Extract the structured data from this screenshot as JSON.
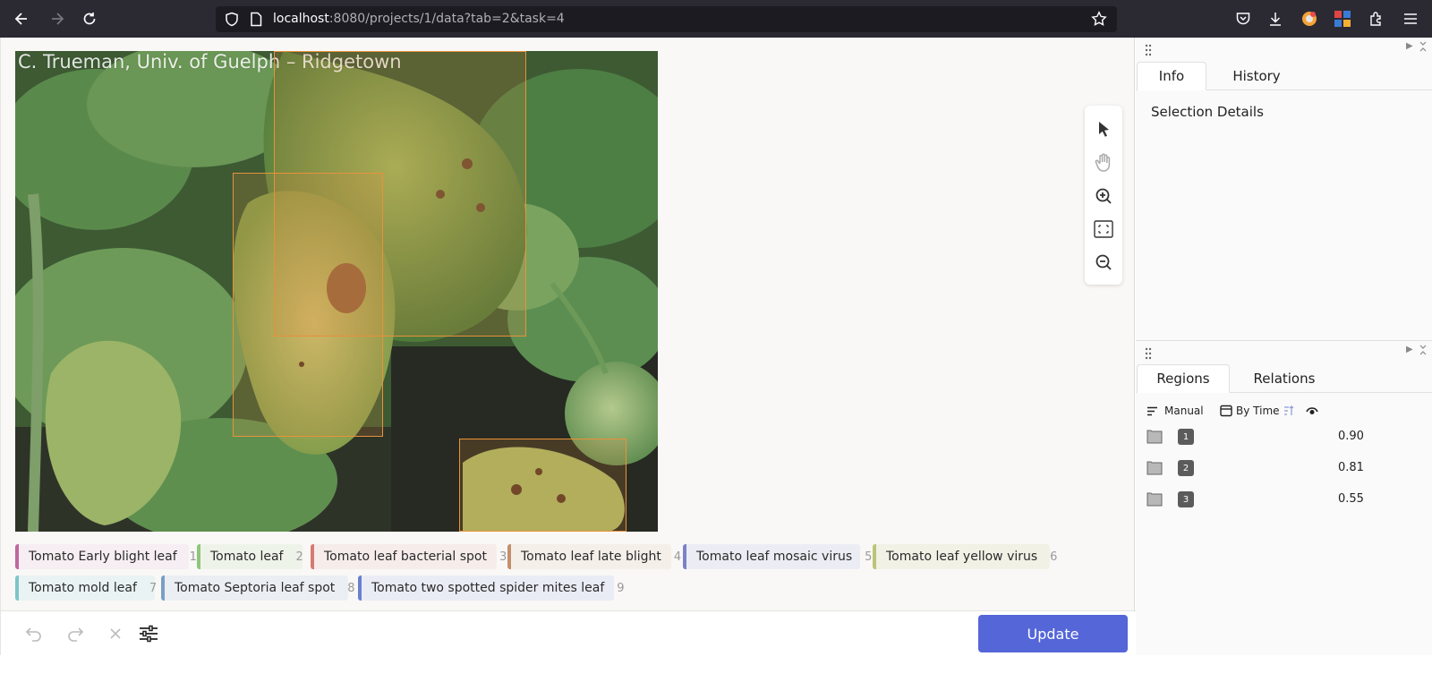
{
  "browser": {
    "url_host": "localhost",
    "url_path": ":8080/projects/1/data?tab=2&task=4"
  },
  "image": {
    "watermark": "C. Trueman, Univ. of Guelph – Ridgetown"
  },
  "labels": [
    {
      "name": "Tomato Early blight leaf",
      "hotkey": "1",
      "color": "#c1679e"
    },
    {
      "name": "Tomato leaf",
      "hotkey": "2",
      "color": "#8fc67a"
    },
    {
      "name": "Tomato leaf bacterial spot",
      "hotkey": "3",
      "color": "#d77a72"
    },
    {
      "name": "Tomato leaf late blight",
      "hotkey": "4",
      "color": "#c48f6c"
    },
    {
      "name": "Tomato leaf mosaic virus",
      "hotkey": "5",
      "color": "#7a82c9"
    },
    {
      "name": "Tomato leaf yellow virus",
      "hotkey": "6",
      "color": "#bcc476"
    },
    {
      "name": "Tomato mold leaf",
      "hotkey": "7",
      "color": "#7cc5c9"
    },
    {
      "name": "Tomato Septoria leaf spot",
      "hotkey": "8",
      "color": "#7c9ec4"
    },
    {
      "name": "Tomato two spotted spider mites leaf",
      "hotkey": "9",
      "color": "#6a7fd0"
    }
  ],
  "actions": {
    "update_label": "Update"
  },
  "sidebar": {
    "top_tabs": [
      "Info",
      "History"
    ],
    "selection_title": "Selection Details",
    "bottom_tabs": [
      "Regions",
      "Relations"
    ],
    "sort_manual": "Manual",
    "sort_by_time": "By Time",
    "regions": [
      {
        "index": "1",
        "score": "0.90"
      },
      {
        "index": "2",
        "score": "0.81"
      },
      {
        "index": "3",
        "score": "0.55"
      }
    ]
  }
}
